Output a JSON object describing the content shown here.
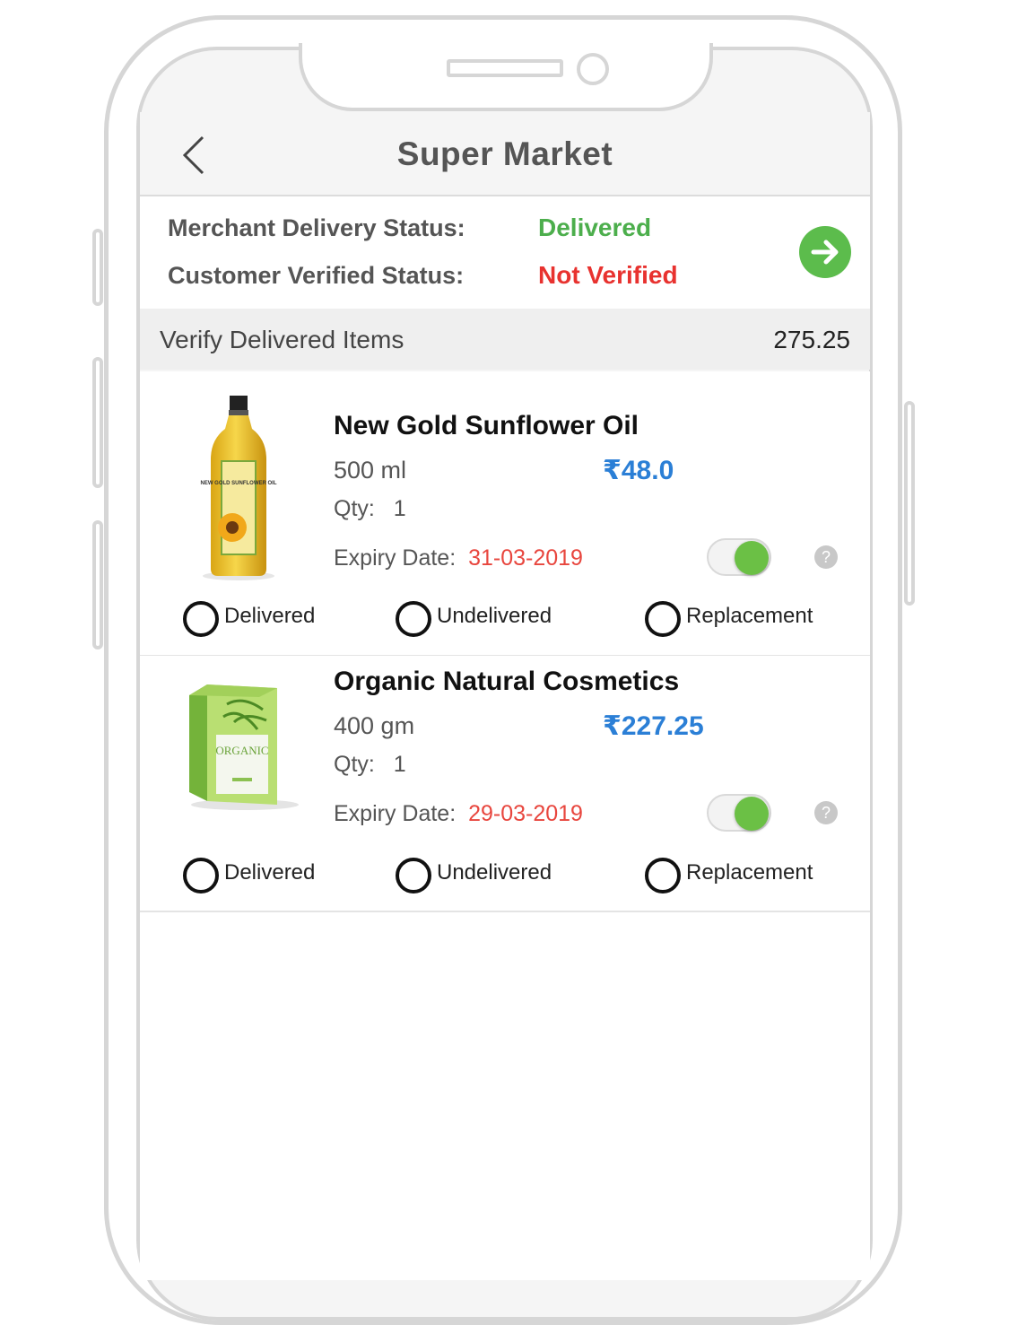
{
  "header": {
    "title": "Super Market"
  },
  "status": {
    "merchant_label": "Merchant Delivery Status:",
    "merchant_value": "Delivered",
    "customer_label": "Customer Verified Status:",
    "customer_value": "Not Verified",
    "colors": {
      "delivered": "#4cae4c",
      "not_verified": "#e8322f",
      "go_button": "#5cbc4c"
    }
  },
  "section": {
    "title": "Verify Delivered Items",
    "total": "275.25"
  },
  "items": [
    {
      "name": "New Gold Sunflower Oil",
      "size": "500 ml",
      "price": "₹48.0",
      "qty_label": "Qty:",
      "qty": "1",
      "expiry_label": "Expiry Date:",
      "expiry": "31-03-2019",
      "image_label": "NEW GOLD SUNFLOWER OIL",
      "toggle_on": true,
      "options": [
        "Delivered",
        "Undelivered",
        "Replacement"
      ]
    },
    {
      "name": "Organic  Natural Cosmetics",
      "size": "400 gm",
      "price": "₹227.25",
      "qty_label": "Qty:",
      "qty": "1",
      "expiry_label": "Expiry Date:",
      "expiry": "29-03-2019",
      "image_label": "ORGANIC",
      "toggle_on": true,
      "options": [
        "Delivered",
        "Undelivered",
        "Replacement"
      ]
    }
  ],
  "icons": [
    "back-chevron-icon",
    "arrow-right-circle-icon",
    "help-icon",
    "radio-icon",
    "toggle-icon"
  ],
  "accent_colors": {
    "price": "#2b7fd6",
    "expiry": "#e8463e",
    "toggle": "#6bc045"
  }
}
